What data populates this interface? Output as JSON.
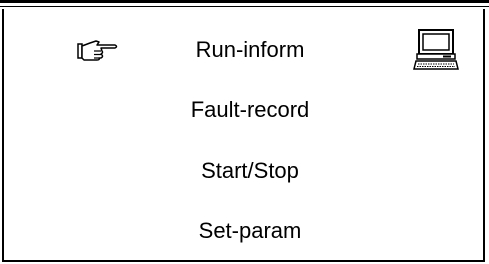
{
  "menu": {
    "items": [
      {
        "label": "Run-inform",
        "selected": true
      },
      {
        "label": "Fault-record",
        "selected": false
      },
      {
        "label": "Start/Stop",
        "selected": false
      },
      {
        "label": "Set-param",
        "selected": false
      }
    ]
  },
  "icons": {
    "cursor": "pointing-hand-icon",
    "status": "computer-icon"
  }
}
